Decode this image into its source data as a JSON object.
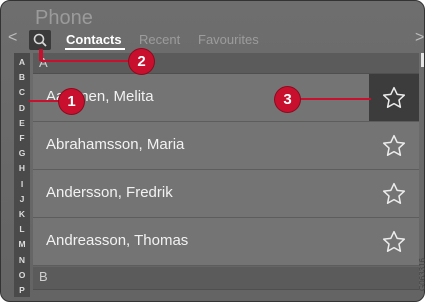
{
  "app": {
    "title": "Phone"
  },
  "nav": {
    "left_arrow": "<",
    "right_arrow": ">"
  },
  "tabs": [
    {
      "label": "Contacts",
      "active": true
    },
    {
      "label": "Recent",
      "active": false
    },
    {
      "label": "Favourites",
      "active": false
    }
  ],
  "alphabet": [
    "A",
    "B",
    "C",
    "D",
    "E",
    "F",
    "G",
    "H",
    "I",
    "J",
    "K",
    "L",
    "M",
    "N",
    "O",
    "P"
  ],
  "sections": [
    "A",
    "B"
  ],
  "contacts": [
    {
      "name": "Aaltonen, Melita",
      "favourite_selected": true
    },
    {
      "name": "Abrahamsson, Maria",
      "favourite_selected": false
    },
    {
      "name": "Andersson, Fredrik",
      "favourite_selected": false
    },
    {
      "name": "Andreasson, Thomas",
      "favourite_selected": false
    }
  ],
  "callouts": [
    "1",
    "2",
    "3"
  ],
  "figure_code": "G063316",
  "colors": {
    "callout": "#c8102e",
    "background": "#6b6b6b"
  }
}
